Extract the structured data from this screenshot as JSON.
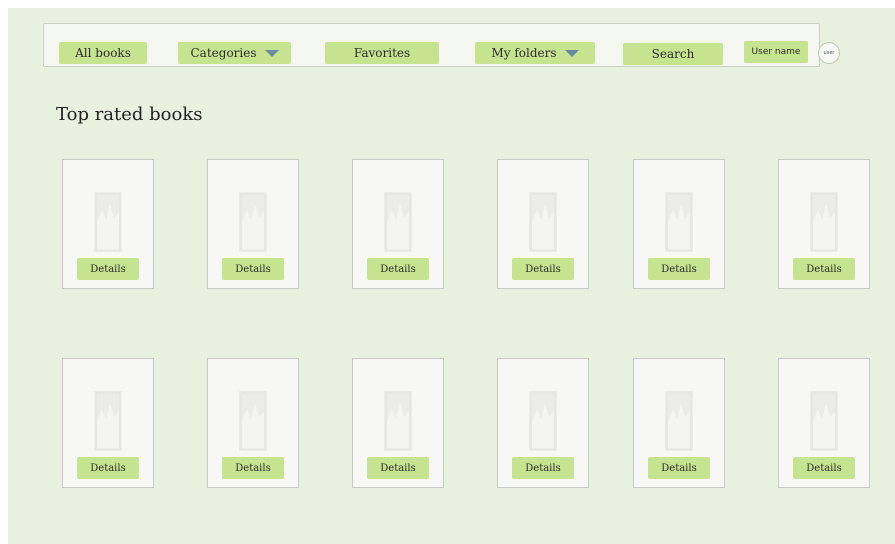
{
  "nav": {
    "all_books": "All books",
    "categories": "Categories",
    "favorites": "Favorites",
    "my_folders": "My folders",
    "search": "Search",
    "user_name": "User name",
    "avatar_text": "user"
  },
  "main": {
    "section_title": "Top rated books",
    "details_label": "Details"
  },
  "colors": {
    "background": "#e8f1e0",
    "button": "#c6e38f",
    "caret": "#6b8aa0"
  }
}
